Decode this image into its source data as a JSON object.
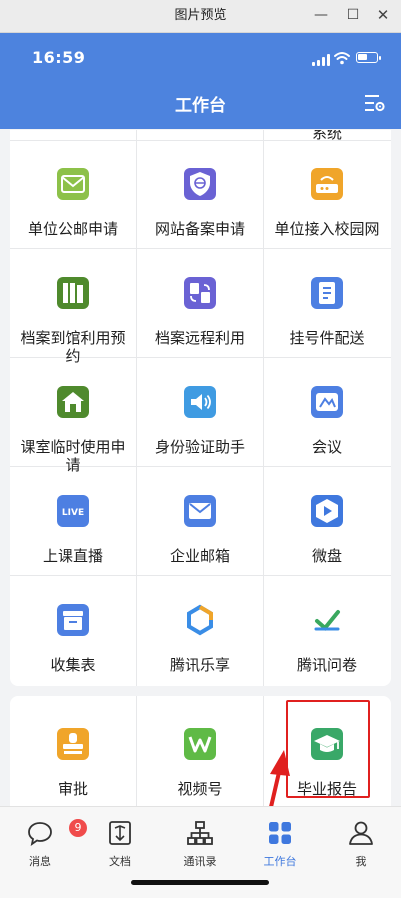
{
  "window": {
    "title": "图片预览",
    "minimize": "—",
    "maximize": "☐",
    "close": "✕"
  },
  "status_bar": {
    "time": "16:59",
    "battery_level": 0.55
  },
  "header": {
    "title": "工作台",
    "settings_icon": "settings-list-icon"
  },
  "grid": {
    "partial_label": "系统",
    "items": [
      {
        "label": "单位公邮申请",
        "icon": "mail-envelope-icon",
        "color": "#8dc149"
      },
      {
        "label": "网站备案申请",
        "icon": "shield-globe-icon",
        "color": "#6a62d4"
      },
      {
        "label": "单位接入校园网",
        "icon": "router-icon",
        "color": "#f0a52a"
      },
      {
        "label": "档案到馆利用预约",
        "icon": "archive-files-icon",
        "color": "#4f8a2d"
      },
      {
        "label": "档案远程利用",
        "icon": "remote-docs-icon",
        "color": "#6a62d4"
      },
      {
        "label": "挂号件配送",
        "icon": "document-list-icon",
        "color": "#4d7fe2"
      },
      {
        "label": "课室临时使用申请",
        "icon": "classroom-icon",
        "color": "#4f8a2d"
      },
      {
        "label": "身份验证助手",
        "icon": "speaker-icon",
        "color": "#3f9be2"
      },
      {
        "label": "会议",
        "icon": "meeting-icon",
        "color": "#4d7fe2"
      },
      {
        "label": "上课直播",
        "icon": "live-icon",
        "color": "#4d7fe2"
      },
      {
        "label": "企业邮箱",
        "icon": "mailbox-icon",
        "color": "#4d7fe2"
      },
      {
        "label": "微盘",
        "icon": "cloud-drive-icon",
        "color": "#3f78de"
      },
      {
        "label": "收集表",
        "icon": "collect-form-icon",
        "color": "#4d7fe2"
      },
      {
        "label": "腾讯乐享",
        "icon": "lexiang-icon",
        "color": "#3a8de6"
      },
      {
        "label": "腾讯问卷",
        "icon": "questionnaire-icon",
        "color": "#3aa85f"
      }
    ],
    "bottom_items": [
      {
        "label": "审批",
        "icon": "stamp-icon",
        "color": "#f0a52a"
      },
      {
        "label": "视频号",
        "icon": "video-channel-icon",
        "color": "#5fba46"
      },
      {
        "label": "毕业报告",
        "icon": "graduation-cap-icon",
        "color": "#39a868"
      }
    ]
  },
  "tabbar": {
    "tabs": [
      {
        "label": "消息",
        "icon": "message-bubble-icon",
        "badge": "9"
      },
      {
        "label": "文档",
        "icon": "document-icon"
      },
      {
        "label": "通讯录",
        "icon": "org-chart-icon"
      },
      {
        "label": "工作台",
        "icon": "workbench-grid-icon",
        "active": true
      },
      {
        "label": "我",
        "icon": "person-icon"
      }
    ]
  }
}
